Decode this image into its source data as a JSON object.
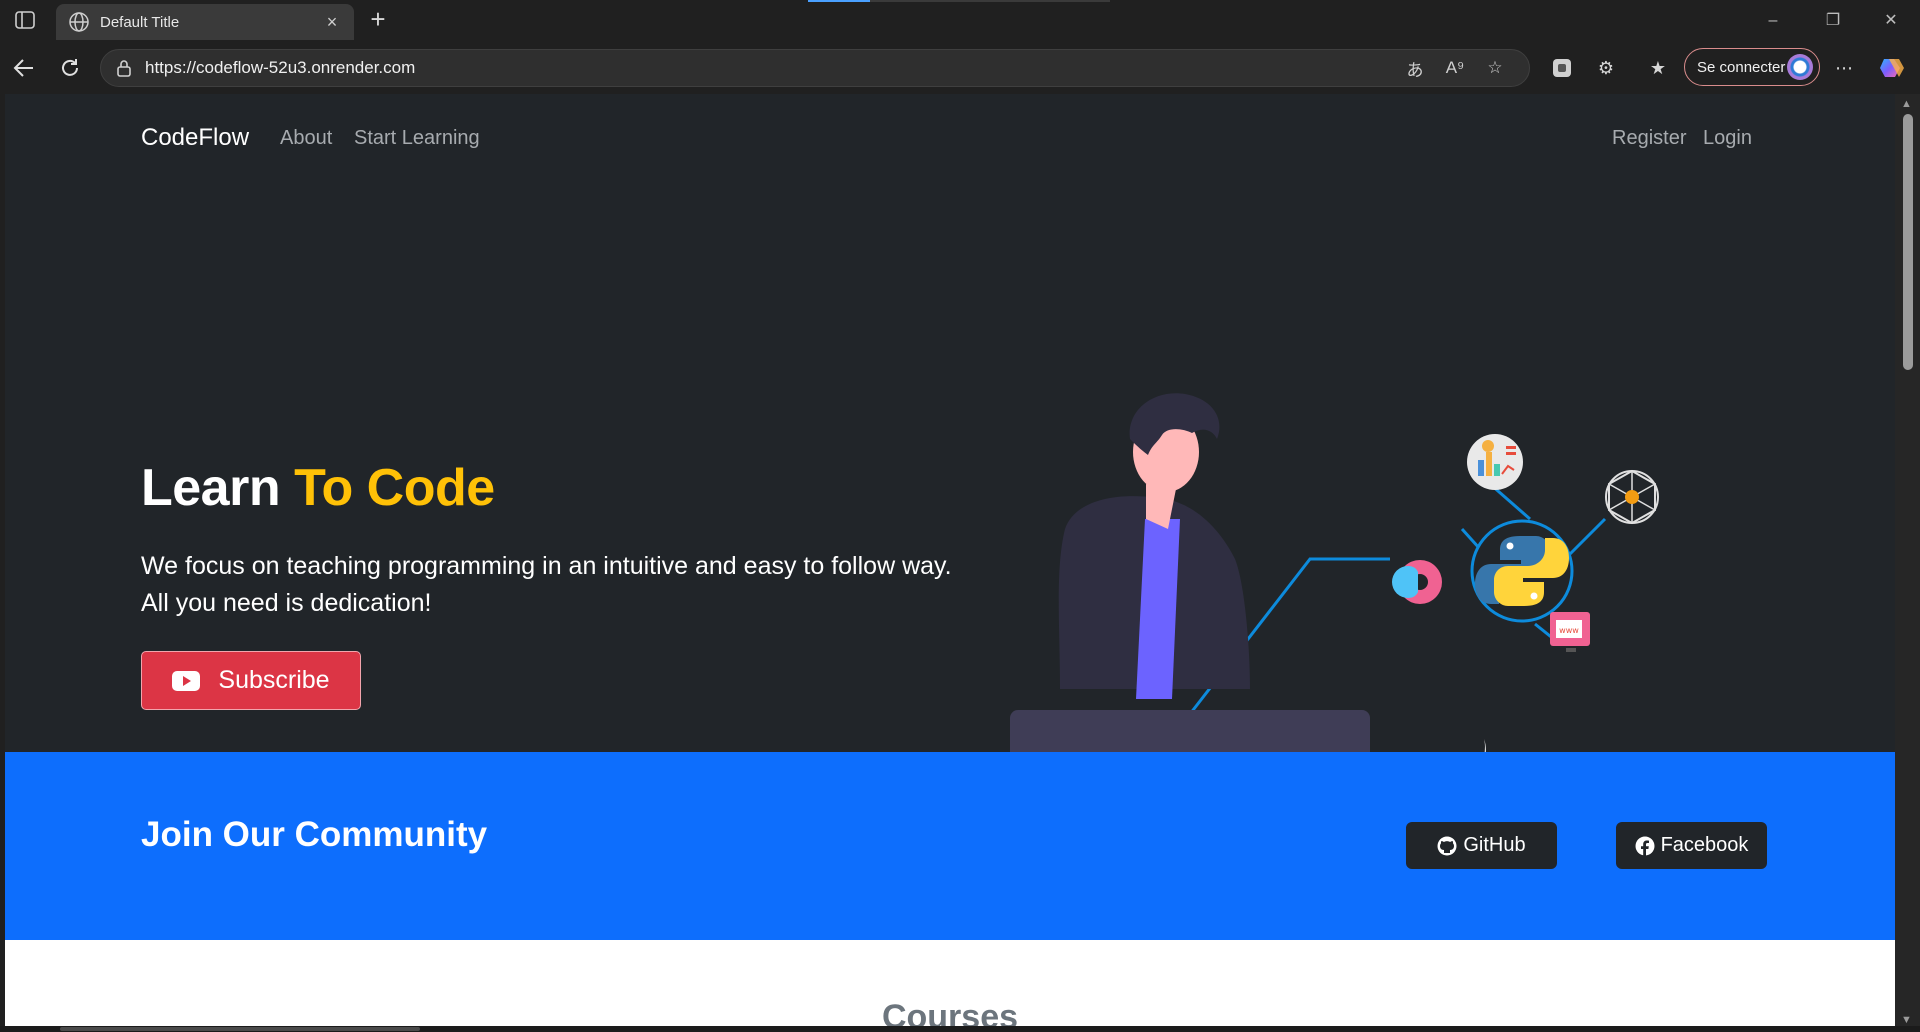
{
  "browser": {
    "tab_title": "Default Title",
    "url": "https://codeflow-52u3.onrender.com",
    "signin_label": "Se connecter",
    "new_tab_symbol": "+",
    "tab_close_symbol": "×"
  },
  "site": {
    "brand": "CodeFlow",
    "nav_left": [
      "About",
      "Start Learning"
    ],
    "nav_right": [
      "Register",
      "Login"
    ]
  },
  "hero": {
    "title_part1": "Learn ",
    "title_accent": "To Code",
    "description": "We focus on teaching programming in an intuitive and easy to follow way. All you need is dedication!",
    "subscribe_label": "Subscribe"
  },
  "community": {
    "title": "Join Our Community",
    "github_label": "GitHub",
    "facebook_label": "Facebook"
  },
  "courses": {
    "title": "Courses"
  },
  "colors": {
    "background": "#212529",
    "accent": "#ffc107",
    "primary": "#0d6efd",
    "danger": "#dc3545",
    "laptop": "#3f3d56",
    "python_blue": "#3776ab",
    "python_yellow": "#ffd43b"
  },
  "icons": [
    "sidebar-toggle-icon",
    "globe-icon",
    "back-icon",
    "refresh-icon",
    "lock-icon",
    "translate-icon",
    "read-aloud-icon",
    "star-icon",
    "extensions-icon",
    "favorites-icon",
    "more-icon",
    "copilot-icon",
    "youtube-icon",
    "github-icon",
    "facebook-icon"
  ]
}
